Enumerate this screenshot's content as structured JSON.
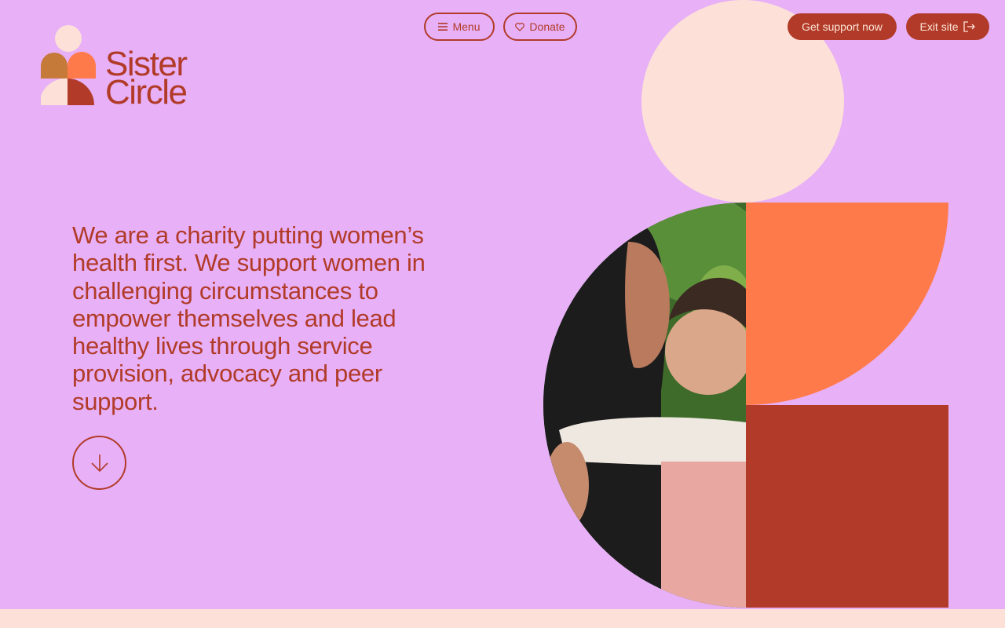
{
  "brand": {
    "name": "Sister\nCircle",
    "colors": {
      "background": "#e7b0f7",
      "primary": "#b13b28",
      "coral": "#ff7a4a",
      "peach": "#fde1d8",
      "ochre": "#c57a3a"
    }
  },
  "header": {
    "menu": {
      "label": "Menu",
      "icon": "hamburger-icon"
    },
    "donate": {
      "label": "Donate",
      "icon": "heart-icon"
    },
    "get_support": {
      "label": "Get support now"
    },
    "exit": {
      "label": "Exit site",
      "icon": "exit-icon"
    }
  },
  "hero": {
    "text": "We are a charity putting women’s health first. We support women in challenging circumstances to empower themselves and lead healthy lives through service provision, advocacy and peer support.",
    "scroll_icon": "arrow-down-icon",
    "image_description_icon": "mother-and-child-photo"
  }
}
